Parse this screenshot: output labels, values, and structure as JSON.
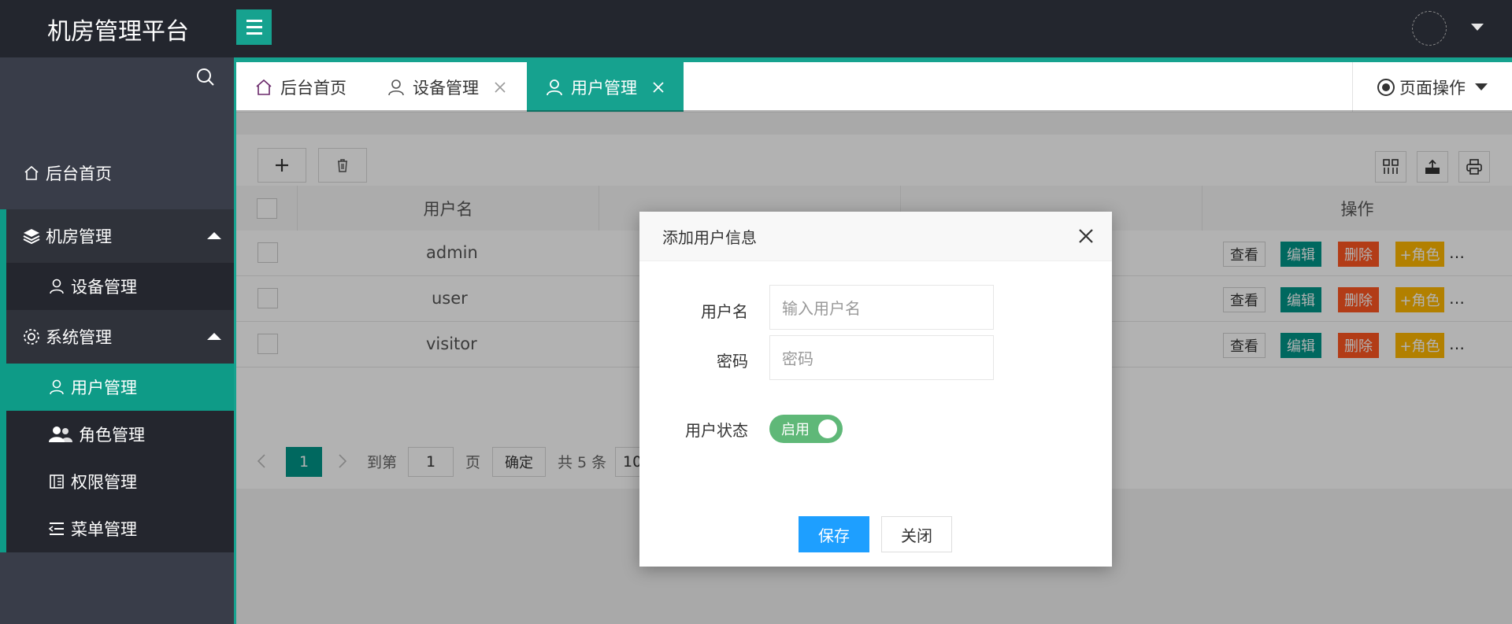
{
  "app": {
    "title": "机房管理平台"
  },
  "sidebar": {
    "items": [
      {
        "label": "后台首页",
        "icon": "home-icon"
      },
      {
        "label": "机房管理",
        "icon": "layers-icon"
      },
      {
        "label": "设备管理",
        "icon": "user-icon"
      },
      {
        "label": "系统管理",
        "icon": "gear-icon"
      },
      {
        "label": "用户管理",
        "icon": "user-icon"
      },
      {
        "label": "角色管理",
        "icon": "users-icon"
      },
      {
        "label": "权限管理",
        "icon": "permission-icon"
      },
      {
        "label": "菜单管理",
        "icon": "menu-list-icon"
      }
    ],
    "active": "用户管理"
  },
  "tabs": [
    {
      "label": "后台首页",
      "closable": false
    },
    {
      "label": "设备管理",
      "closable": true
    },
    {
      "label": "用户管理",
      "closable": true,
      "active": true
    }
  ],
  "page_ops": {
    "label": "页面操作"
  },
  "table": {
    "columns": [
      "用户名",
      "操作"
    ],
    "rows": [
      {
        "username": "admin"
      },
      {
        "username": "user"
      },
      {
        "username": "visitor"
      }
    ],
    "actions": {
      "view": "查看",
      "edit": "编辑",
      "delete": "删除",
      "role": "+角色",
      "more": "…"
    }
  },
  "pager": {
    "current": "1",
    "goto_label": "到第",
    "goto_value": "1",
    "page_unit": "页",
    "confirm": "确定",
    "total": "共 5 条",
    "page_size": "10"
  },
  "modal": {
    "title": "添加用户信息",
    "fields": {
      "username_label": "用户名",
      "username_placeholder": "输入用户名",
      "password_label": "密码",
      "password_placeholder": "密码",
      "status_label": "用户状态",
      "status_value": "启用"
    },
    "save": "保存",
    "close": "关闭"
  },
  "colors": {
    "accent": "#16a28f",
    "save": "#1e9fff",
    "switch_on": "#5fb878"
  }
}
